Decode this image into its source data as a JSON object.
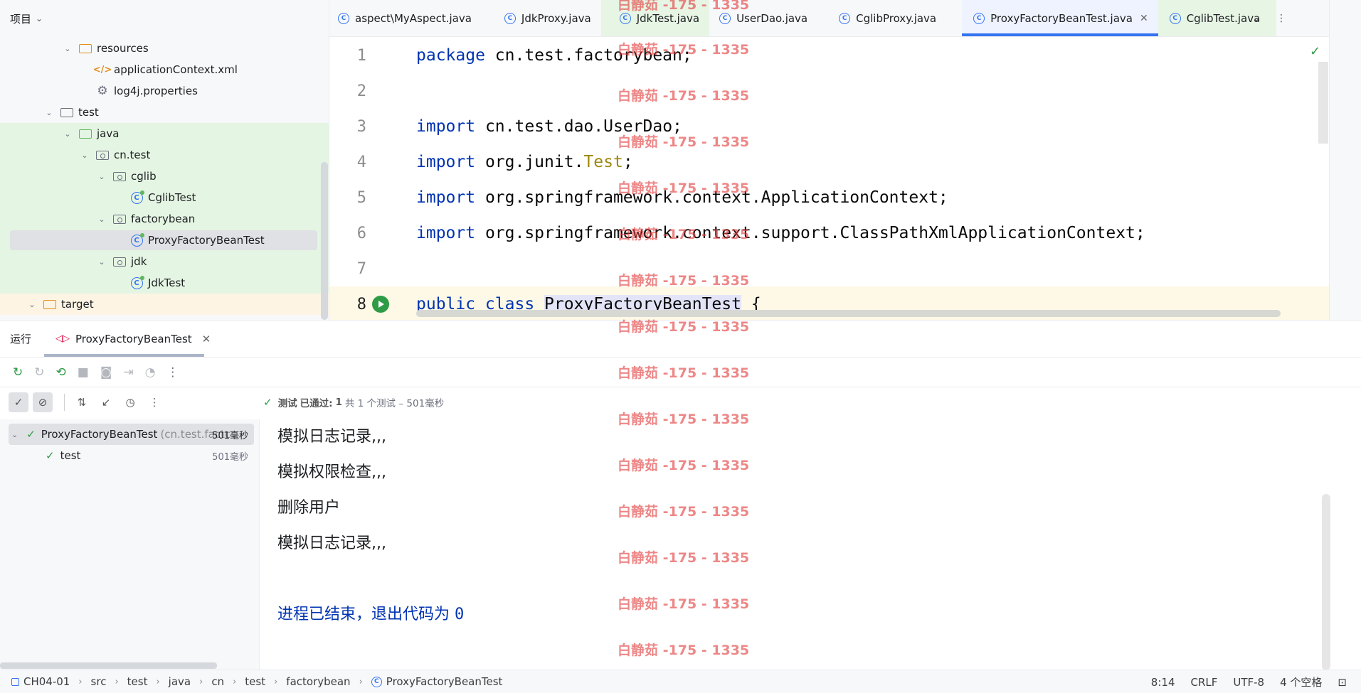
{
  "project": {
    "title": "项目",
    "tree": [
      {
        "label": "resources",
        "icon": "resources-folder-icon"
      },
      {
        "label": "applicationContext.xml",
        "icon": "xml-file-icon"
      },
      {
        "label": "log4j.properties",
        "icon": "properties-file-icon"
      },
      {
        "label": "test",
        "icon": "folder-icon"
      },
      {
        "label": "java",
        "icon": "test-source-folder-icon"
      },
      {
        "label": "cn.test",
        "icon": "package-icon"
      },
      {
        "label": "cglib",
        "icon": "package-icon"
      },
      {
        "label": "CglibTest",
        "icon": "test-class-icon"
      },
      {
        "label": "factorybean",
        "icon": "package-icon"
      },
      {
        "label": "ProxyFactoryBeanTest",
        "icon": "test-class-icon"
      },
      {
        "label": "jdk",
        "icon": "package-icon"
      },
      {
        "label": "JdkTest",
        "icon": "test-class-icon"
      },
      {
        "label": "target",
        "icon": "excluded-folder-icon"
      }
    ]
  },
  "tabs": [
    {
      "label": "aspect\\MyAspect.java",
      "icon": "c"
    },
    {
      "label": "JdkProxy.java",
      "icon": "c"
    },
    {
      "label": "JdkTest.java",
      "icon": "c"
    },
    {
      "label": "UserDao.java",
      "icon": "c"
    },
    {
      "label": "CglibProxy.java",
      "icon": "c"
    },
    {
      "label": "ProxyFactoryBeanTest.java",
      "icon": "c"
    },
    {
      "label": "CglibTest.java",
      "icon": "c"
    }
  ],
  "editor": {
    "line_numbers": [
      "1",
      "2",
      "3",
      "4",
      "5",
      "6",
      "7",
      "8"
    ],
    "lines": {
      "l1_kw": "package",
      "l1_rest": " cn.test.factorybean;",
      "l3_kw": "import",
      "l3_rest": " cn.test.dao.UserDao;",
      "l4_kw": "import",
      "l4_mid": " org.junit.",
      "l4_ann": "Test",
      "l4_end": ";",
      "l5_kw": "import",
      "l5_rest": " org.springframework.context.ApplicationContext;",
      "l6_kw": "import",
      "l6_rest": " org.springframework.context.support.ClassPathXmlApplicationContext;",
      "l8_kw": "public class ",
      "l8_name": "ProxyFactoryBeanTest",
      "l8_end": " {"
    }
  },
  "run": {
    "title": "运行",
    "tab_label": "ProxyFactoryBeanTest",
    "status": {
      "prefix": "测试",
      "passed_label": "已通过:",
      "passed_count": "1",
      "summary": "共 1 个测试 – 501毫秒"
    },
    "tree": {
      "root_label": "ProxyFactoryBeanTest",
      "root_pkg": "(cn.test.factc",
      "root_time": "501毫秒",
      "child_label": "test",
      "child_time": "501毫秒"
    },
    "console": {
      "line1": "模拟日志记录,,,",
      "line2": "模拟权限检查,,,",
      "line3": "删除用户",
      "line4": "模拟日志记录,,,",
      "exit_text": "进程已结束，退出代码为 ",
      "exit_code": "0"
    }
  },
  "statusbar": {
    "crumbs": [
      "CH04-01",
      "src",
      "test",
      "java",
      "cn",
      "test",
      "factorybean",
      "ProxyFactoryBeanTest"
    ],
    "position": "8:14",
    "line_sep": "CRLF",
    "encoding": "UTF-8",
    "indent": "4 个空格"
  },
  "watermark": "白静茹 -175 - 1335"
}
